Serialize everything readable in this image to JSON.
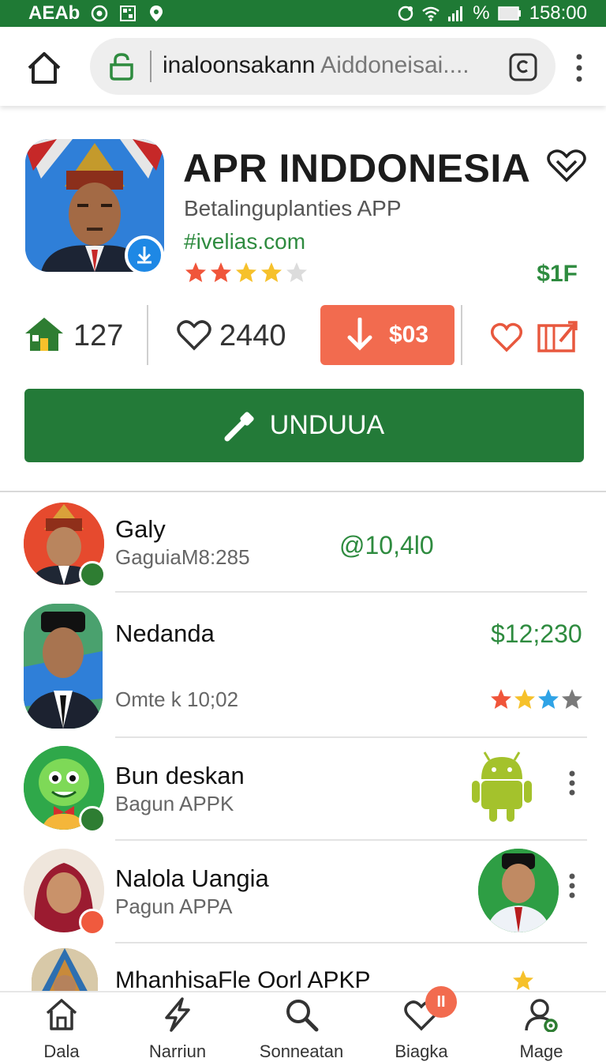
{
  "status_bar": {
    "carrier": "AEAb",
    "battery_percent_symbol": "%",
    "time": "158:00"
  },
  "browser": {
    "url_host": "inaloonsakann",
    "url_rest": " Aiddoneisai....",
    "home_icon": "home-icon",
    "lock_icon": "lock-icon",
    "tabs_icon": "tabs-icon",
    "menu_icon": "kebab-menu-icon"
  },
  "app": {
    "title": "APR INDDONESIA",
    "subtitle": "Betalinguplanties APP",
    "link": "#ivelias.com",
    "price": "$1F",
    "rating": 4,
    "rating_max": 5
  },
  "stats": {
    "home_count": "127",
    "likes_count": "2440",
    "download_price": "$03"
  },
  "main_button": {
    "label": "UNDUUA"
  },
  "list": [
    {
      "name": "Galy",
      "sub": "GaguiaM8:285",
      "value": "@10,4l0"
    },
    {
      "name": "Nedanda",
      "sub": "Omte k 10;02",
      "value": "$12;230",
      "rating": 2.5,
      "rating_max": 4
    },
    {
      "name": "Bun deskan",
      "sub": "Bagun APPK"
    },
    {
      "name": "Nalola Uangia",
      "sub": "Pagun APPA"
    },
    {
      "name": "MhanhisaFle Oorl APKP",
      "sub": ""
    }
  ],
  "bottom_nav": [
    {
      "label": "Dala",
      "icon": "home-outline-icon"
    },
    {
      "label": "Narriun",
      "icon": "lightning-icon"
    },
    {
      "label": "Sonneatan",
      "icon": "search-icon"
    },
    {
      "label": "Biagka",
      "icon": "heart-icon",
      "badge": "II"
    },
    {
      "label": "Mage",
      "icon": "profile-icon"
    }
  ],
  "colors": {
    "brand_green": "#237a38",
    "accent_orange": "#f26b4f",
    "price_green": "#2e8b3f"
  }
}
